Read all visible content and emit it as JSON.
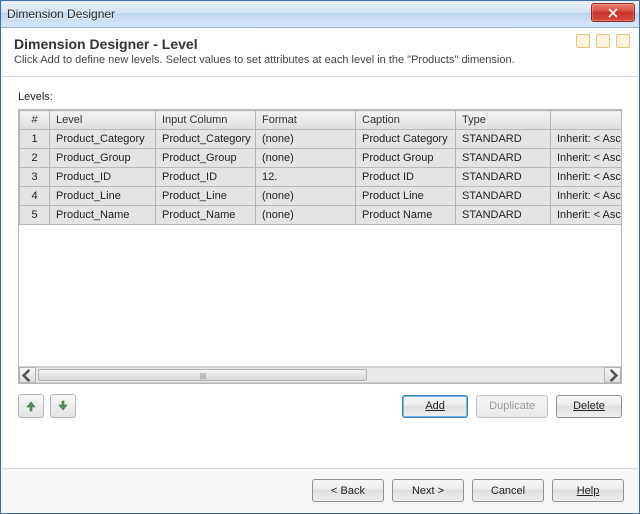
{
  "window": {
    "title": "Dimension Designer"
  },
  "header": {
    "title": "Dimension Designer - Level",
    "subtitle": "Click Add to define new levels. Select values to set attributes at each level in the \"Products\" dimension."
  },
  "grid": {
    "section_label": "Levels:",
    "columns": [
      "#",
      "Level",
      "Input Column",
      "Format",
      "Caption",
      "Type",
      ""
    ],
    "rows": [
      {
        "num": "1",
        "level": "Product_Category",
        "input": "Product_Category",
        "format": "(none)",
        "caption": "Product Category",
        "type": "STANDARD",
        "extra": "Inherit: < Asc"
      },
      {
        "num": "2",
        "level": "Product_Group",
        "input": "Product_Group",
        "format": "(none)",
        "caption": "Product Group",
        "type": "STANDARD",
        "extra": "Inherit: < Asc"
      },
      {
        "num": "3",
        "level": "Product_ID",
        "input": "Product_ID",
        "format": "12.",
        "caption": "Product ID",
        "type": "STANDARD",
        "extra": "Inherit: < Asc"
      },
      {
        "num": "4",
        "level": "Product_Line",
        "input": "Product_Line",
        "format": "(none)",
        "caption": "Product Line",
        "type": "STANDARD",
        "extra": "Inherit: < Asc"
      },
      {
        "num": "5",
        "level": "Product_Name",
        "input": "Product_Name",
        "format": "(none)",
        "caption": "Product Name",
        "type": "STANDARD",
        "extra": "Inherit: < Asc"
      }
    ]
  },
  "buttons": {
    "add": "Add",
    "duplicate": "Duplicate",
    "delete": "Delete",
    "back": "< Back",
    "next": "Next >",
    "cancel": "Cancel",
    "help": "Help"
  }
}
